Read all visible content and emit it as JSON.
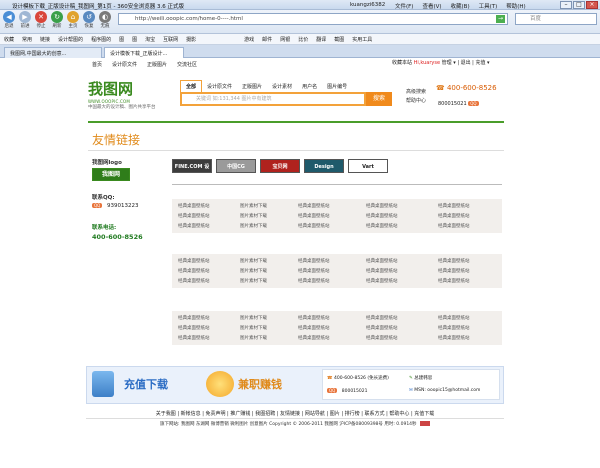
{
  "browser": {
    "window_title": "设计模板下载_正版设计稿_我图网_第1页 - 360安全浏览器 3.6 正式版",
    "user": "kuangzi6382",
    "menus": [
      "文件(F)",
      "查看(V)",
      "收藏(B)",
      "工具(T)",
      "帮助(H)"
    ],
    "nav_buttons": [
      "后退",
      "前进",
      "停止",
      "刷新",
      "主页",
      "恢复",
      "无痕"
    ],
    "address": "http://weili.ooopic.com/home-0----.html",
    "search_placeholder": "百度",
    "favorites": [
      "收藏",
      "常用",
      "链接",
      "设计帮图的",
      "程序图的",
      "图",
      "图",
      "淘宝",
      "互联网",
      "摄影"
    ],
    "favorites_right": [
      "游戏",
      "邮件",
      "网银",
      "比价",
      "翻译",
      "截图",
      "实用工具"
    ],
    "tabs": [
      "我图网,中国最大的创意...",
      "设计模板下载_正版设计..."
    ],
    "colors": {
      "accent_orange": "#f08a1c",
      "brand_green": "#3a8a1f",
      "title_orange": "#e08a1a"
    }
  },
  "site": {
    "topnav": [
      "首页",
      "设计原文件",
      "正版图片",
      "交流社区"
    ],
    "topnav_right_prefix": "收藏本站",
    "topnav_user": "Hi,kuaryse",
    "topnav_right_suffix": "管理 ▾ | 退出 | 充值 ▾",
    "logo_mark": "我图网",
    "logo_url": "WWW.OOOPIC.COM",
    "logo_slogan": "中国最大的设计稿、图片共享平台",
    "search_tabs": [
      "全部",
      "设计原文件",
      "正版图片",
      "设计素材",
      "用户名",
      "图片编号"
    ],
    "search_placeholder": "关键词 如:131,344 图片中有建筑",
    "search_button": "搜索",
    "hot_label1": "高级搜索",
    "hot_label2": "帮助中心",
    "phone": "400-600-8526",
    "qq": "800015021"
  },
  "page": {
    "title": "友情链接",
    "left": {
      "logo_heading": "我图网logo",
      "logo_text": "我图网",
      "qq_heading": "联系QQ:",
      "qq_number": "939013223",
      "phone_heading": "联系电话:",
      "phone": "400-600-8526"
    },
    "friend_logos": [
      {
        "text": "FINE.COM 设视天地",
        "bg": "#3c3c3c"
      },
      {
        "text": "中国CG",
        "bg": "#9a9a9a"
      },
      {
        "text": "宝贝网",
        "bg": "#b0221e"
      },
      {
        "text": "Design",
        "bg": "#1f5a6b"
      },
      {
        "text": "Vart",
        "bg": "#ffffff"
      }
    ],
    "blocks": [
      {
        "rows": [
          [
            "经典桌面壁纸站",
            "图片素材下载",
            "经典桌面壁纸站",
            "经典桌面壁纸站",
            "经典桌面壁纸站"
          ],
          [
            "经典桌面壁纸站",
            "图片素材下载",
            "经典桌面壁纸站",
            "经典桌面壁纸站",
            "经典桌面壁纸站"
          ],
          [
            "经典桌面壁纸站",
            "图片素材下载",
            "经典桌面壁纸站",
            "经典桌面壁纸站",
            "经典桌面壁纸站"
          ]
        ]
      },
      {
        "rows": [
          [
            "经典桌面壁纸站",
            "图片素材下载",
            "经典桌面壁纸站",
            "经典桌面壁纸站",
            "经典桌面壁纸站"
          ],
          [
            "经典桌面壁纸站",
            "图片素材下载",
            "经典桌面壁纸站",
            "经典桌面壁纸站",
            "经典桌面壁纸站"
          ],
          [
            "经典桌面壁纸站",
            "图片素材下载",
            "经典桌面壁纸站",
            "经典桌面壁纸站",
            "经典桌面壁纸站"
          ]
        ]
      },
      {
        "rows": [
          [
            "经典桌面壁纸站",
            "图片素材下载",
            "经典桌面壁纸站",
            "经典桌面壁纸站",
            "经典桌面壁纸站"
          ],
          [
            "经典桌面壁纸站",
            "图片素材下载",
            "经典桌面壁纸站",
            "经典桌面壁纸站",
            "经典桌面壁纸站"
          ],
          [
            "经典桌面壁纸站",
            "图片素材下载",
            "经典桌面壁纸站",
            "经典桌面壁纸站",
            "经典桌面壁纸站"
          ]
        ]
      }
    ]
  },
  "footer": {
    "banner1": "充值下载",
    "banner2": "兼职赚钱",
    "contact_phone": "400-600-8526 (免长途费)",
    "contact_qq": "800015021",
    "suggest": "总建韩思",
    "email": "MSN: ooopic15@hotmail.com",
    "links": "关于我图 | 新帐信息 | 免责声明 | 推广赚钱 | 我图招聘 | 友情链接 | 网站导航 | 图片 | 排行榜 | 联系方式 | 帮助中心 | 充值下载",
    "copyright": "旗下网站: 我图网 东湖网 微博营销 微利图片 创意图片    Copyright © 2006-2011 我图网 沪ICP备08009398号 用时: 0.0914秒"
  }
}
